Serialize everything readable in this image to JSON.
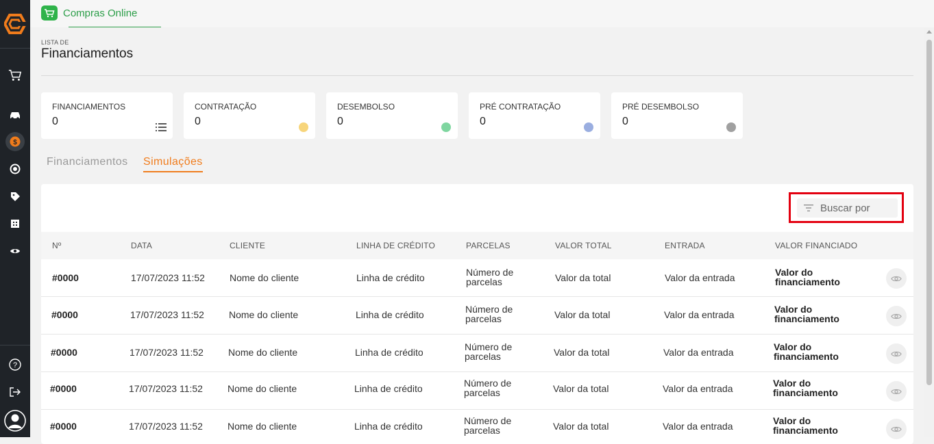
{
  "app": {
    "tab_label": "Compras Online"
  },
  "header": {
    "eyebrow": "LISTA DE",
    "title": "Financiamentos"
  },
  "cards": [
    {
      "label": "FINANCIAMENTOS",
      "value": "0",
      "indicator": "list-icon",
      "color": "#555555"
    },
    {
      "label": "CONTRATAÇÃO",
      "value": "0",
      "indicator": "dot",
      "color": "#f7d57b"
    },
    {
      "label": "DESEMBOLSO",
      "value": "0",
      "indicator": "dot",
      "color": "#7fd6a0"
    },
    {
      "label": "PRÉ CONTRATAÇÃO",
      "value": "0",
      "indicator": "dot",
      "color": "#9aaee0"
    },
    {
      "label": "PRÉ DESEMBOLSO",
      "value": "0",
      "indicator": "dot",
      "color": "#a0a0a0"
    }
  ],
  "tabs": [
    {
      "label": "Financiamentos",
      "active": false
    },
    {
      "label": "Simulações",
      "active": true
    }
  ],
  "search": {
    "label": "Buscar por"
  },
  "table": {
    "columns": [
      "Nº",
      "DATA",
      "CLIENTE",
      "LINHA DE CRÉDITO",
      "PARCELAS",
      "VALOR TOTAL",
      "ENTRADA",
      "VALOR FINANCIADO"
    ],
    "rows": [
      {
        "id": "#0000",
        "data": "17/07/2023 11:52",
        "cliente": "Nome do cliente",
        "linha": "Linha de crédito",
        "parcelas_1": "Número de",
        "parcelas_2": "parcelas",
        "total": "Valor da total",
        "entrada": "Valor da entrada",
        "financiado_1": "Valor do",
        "financiado_2": "financiamento"
      },
      {
        "id": "#0000",
        "data": "17/07/2023 11:52",
        "cliente": "Nome do cliente",
        "linha": "Linha de crédito",
        "parcelas_1": "Número de",
        "parcelas_2": "parcelas",
        "total": "Valor da total",
        "entrada": "Valor da entrada",
        "financiado_1": "Valor do",
        "financiado_2": "financiamento"
      },
      {
        "id": "#0000",
        "data": "17/07/2023 11:52",
        "cliente": "Nome do cliente",
        "linha": "Linha de crédito",
        "parcelas_1": "Número de",
        "parcelas_2": "parcelas",
        "total": "Valor da total",
        "entrada": "Valor da entrada",
        "financiado_1": "Valor do",
        "financiado_2": "financiamento"
      },
      {
        "id": "#0000",
        "data": "17/07/2023 11:52",
        "cliente": "Nome do cliente",
        "linha": "Linha de crédito",
        "parcelas_1": "Número de",
        "parcelas_2": "parcelas",
        "total": "Valor da total",
        "entrada": "Valor da entrada",
        "financiado_1": "Valor do",
        "financiado_2": "financiamento"
      },
      {
        "id": "#0000",
        "data": "17/07/2023 11:52",
        "cliente": "Nome do cliente",
        "linha": "Linha de crédito",
        "parcelas_1": "Número de",
        "parcelas_2": "parcelas",
        "total": "Valor da total",
        "entrada": "Valor da entrada",
        "financiado_1": "Valor do",
        "financiado_2": "financiamento"
      }
    ]
  },
  "sidebar": {
    "icons": [
      "logo-icon",
      "cart-icon",
      "car-icon",
      "money-icon",
      "refresh-money-icon",
      "tag-icon",
      "building-icon",
      "eye-icon",
      "help-icon",
      "logout-icon",
      "user-icon"
    ]
  },
  "colors": {
    "accent_orange": "#f07c1c",
    "app_green": "#2a9d47",
    "highlight_red": "#e3000f",
    "sidebar_bg": "#1f2328"
  }
}
